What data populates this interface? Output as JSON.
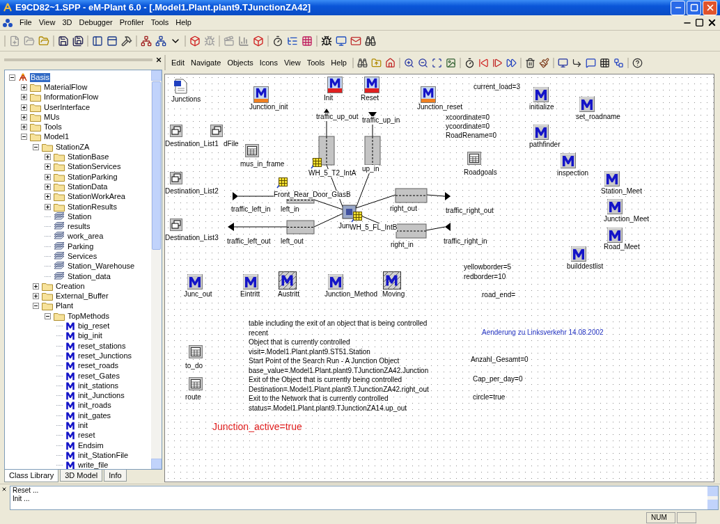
{
  "window": {
    "title": "E9CD82~1.SPP - eM-Plant 6.0 - [.Model1.Plant.plant9.TJunctionZA42]"
  },
  "menu": [
    "File",
    "View",
    "3D",
    "Debugger",
    "Profiler",
    "Tools",
    "Help"
  ],
  "class_library": {
    "tree": [
      {
        "label": "Basis",
        "kind": "root",
        "expanded": true,
        "selected": true,
        "children": [
          {
            "label": "MaterialFlow",
            "kind": "folder",
            "expanded": false,
            "selected": false
          },
          {
            "label": "InformationFlow",
            "kind": "folder",
            "expanded": false,
            "selected": false
          },
          {
            "label": "UserInterface",
            "kind": "folder",
            "expanded": false,
            "selected": false
          },
          {
            "label": "MUs",
            "kind": "folder",
            "expanded": false,
            "selected": false
          },
          {
            "label": "Tools",
            "kind": "folder",
            "expanded": false,
            "selected": false
          },
          {
            "label": "Model1",
            "kind": "folder",
            "expanded": true,
            "selected": false,
            "children": [
              {
                "label": "StationZA",
                "kind": "folder",
                "expanded": true,
                "selected": false,
                "children": [
                  {
                    "label": "StationBase",
                    "kind": "folder",
                    "expanded": false,
                    "selected": false
                  },
                  {
                    "label": "StationServices",
                    "kind": "folder",
                    "expanded": false,
                    "selected": false
                  },
                  {
                    "label": "StationParking",
                    "kind": "folder",
                    "expanded": false,
                    "selected": false
                  },
                  {
                    "label": "StationData",
                    "kind": "folder",
                    "expanded": false,
                    "selected": false
                  },
                  {
                    "label": "StationWorkArea",
                    "kind": "folder",
                    "expanded": false,
                    "selected": false
                  },
                  {
                    "label": "StationResults",
                    "kind": "folder",
                    "expanded": false,
                    "selected": false
                  },
                  {
                    "label": "Station",
                    "kind": "frame",
                    "selected": false
                  },
                  {
                    "label": "results",
                    "kind": "frame",
                    "selected": false
                  },
                  {
                    "label": "work_area",
                    "kind": "frame",
                    "selected": false
                  },
                  {
                    "label": "Parking",
                    "kind": "frame",
                    "selected": false
                  },
                  {
                    "label": "Services",
                    "kind": "frame",
                    "selected": false
                  },
                  {
                    "label": "Station_Warehouse",
                    "kind": "frame",
                    "selected": false
                  },
                  {
                    "label": "Station_data",
                    "kind": "frame",
                    "selected": false
                  }
                ]
              },
              {
                "label": "Creation",
                "kind": "folder",
                "expanded": false,
                "selected": false
              },
              {
                "label": "External_Buffer",
                "kind": "folder",
                "expanded": false,
                "selected": false
              },
              {
                "label": "Plant",
                "kind": "folder",
                "expanded": true,
                "selected": false,
                "children": [
                  {
                    "label": "TopMethods",
                    "kind": "folder",
                    "expanded": true,
                    "selected": false,
                    "children": [
                      {
                        "label": "big_reset",
                        "kind": "method",
                        "selected": false
                      },
                      {
                        "label": "big_init",
                        "kind": "method",
                        "selected": false
                      },
                      {
                        "label": "reset_stations",
                        "kind": "method",
                        "selected": false
                      },
                      {
                        "label": "reset_Junctions",
                        "kind": "method",
                        "selected": false
                      },
                      {
                        "label": "reset_roads",
                        "kind": "method",
                        "selected": false
                      },
                      {
                        "label": "reset_Gates",
                        "kind": "method",
                        "selected": false
                      },
                      {
                        "label": "init_stations",
                        "kind": "method",
                        "selected": false
                      },
                      {
                        "label": "init_Junctions",
                        "kind": "method",
                        "selected": false
                      },
                      {
                        "label": "init_roads",
                        "kind": "method",
                        "selected": false
                      },
                      {
                        "label": "init_gates",
                        "kind": "method",
                        "selected": false
                      },
                      {
                        "label": "init",
                        "kind": "method",
                        "selected": false
                      },
                      {
                        "label": "reset",
                        "kind": "method",
                        "selected": false
                      },
                      {
                        "label": "Endsim",
                        "kind": "method",
                        "selected": false
                      },
                      {
                        "label": "init_StationFile",
                        "kind": "method",
                        "selected": false
                      },
                      {
                        "label": "write_file",
                        "kind": "method",
                        "selected": false
                      }
                    ]
                  }
                ]
              }
            ]
          }
        ]
      }
    ],
    "tabs": [
      {
        "label": "Class Library",
        "selected": true
      },
      {
        "label": "3D Model",
        "selected": false
      },
      {
        "label": "Info",
        "selected": false
      }
    ]
  },
  "editor": {
    "menu": [
      "Edit",
      "Navigate",
      "Objects",
      "Icons",
      "View",
      "Tools",
      "Help"
    ],
    "objects": [
      {
        "kind": "document",
        "label": "Junctions"
      },
      {
        "kind": "method_orange",
        "label": "Junction_init"
      },
      {
        "kind": "method_red",
        "label": "Init"
      },
      {
        "kind": "method_red",
        "label": "Reset"
      },
      {
        "kind": "method_orange",
        "label": "Junction_reset"
      },
      {
        "kind": "method",
        "label": "initialize"
      },
      {
        "kind": "method",
        "label": "set_roadname"
      },
      {
        "kind": "frame",
        "label": "Destination_List1"
      },
      {
        "kind": "frame",
        "label": "dFile"
      },
      {
        "kind": "method",
        "label": "pathfinder"
      },
      {
        "kind": "table",
        "label": "mus_in_frame"
      },
      {
        "kind": "source",
        "label": "WH_5_T2_IntA"
      },
      {
        "kind": "table",
        "label": "Roadgoals"
      },
      {
        "kind": "method",
        "label": "inspection"
      },
      {
        "kind": "frame",
        "label": "Destination_List2"
      },
      {
        "kind": "source",
        "label": "Front_Rear_Door_GlasB"
      },
      {
        "kind": "method",
        "label": "Station_Meet"
      },
      {
        "kind": "method",
        "label": "Junction_Meet"
      },
      {
        "kind": "frame",
        "label": "Destination_List3"
      },
      {
        "kind": "method",
        "label": "Road_Meet"
      },
      {
        "kind": "method",
        "label": "builddestlist"
      },
      {
        "kind": "method",
        "label": "Junc_out"
      },
      {
        "kind": "method",
        "label": "Eintritt"
      },
      {
        "kind": "method_hatched",
        "label": "Austritt"
      },
      {
        "kind": "method",
        "label": "Junction_Method"
      },
      {
        "kind": "method_hatched",
        "label": "Moving"
      },
      {
        "kind": "table",
        "label": "to_do"
      },
      {
        "kind": "table",
        "label": "route"
      },
      {
        "kind": "source",
        "label": "WH_5_FL_IntB"
      }
    ],
    "labels": [
      "traffic_up_out",
      "traffic_up_in",
      "up_in",
      "traffic_left_in",
      "left_in",
      "right_out",
      "traffic_right_out",
      "Jun",
      "traffic_left_out",
      "left_out",
      "right_in",
      "traffic_right_in"
    ],
    "attributes": [
      "current_load=3",
      "xcoordinate=0",
      "ycoordinate=0",
      "RoadRename=0",
      "yellowborder=5",
      "redborder=10",
      "road_end=",
      "Anzahl_Gesamt=0",
      "Cap_per_day=0",
      "circle=true"
    ],
    "notes": [
      "table including the exit of an object that is being controlled",
      "recent",
      "Object that is currently controlled",
      "visit=.Model1.Plant.plant9.ST51.Station",
      "Start Point of the Search Run - A Junction Object",
      "base_value=.Model1.Plant.plant9.TJunctionZA42.Junction",
      "Exit of the Object that is currently being controlled",
      "Destination=.Model1.Plant.plant9.TJunctionZA42.right_out",
      "Exit to the Network that is currently controlled",
      "status=.Model1.Plant.plant9.TJunctionZA14.up_out"
    ],
    "comment": "Aenderung zu Linksverkehr 14.08.2002",
    "status_text": "Junction_active=true"
  },
  "console": {
    "lines": [
      "Reset ...",
      "Init ..."
    ]
  },
  "status_bar": {
    "indicator": "NUM"
  }
}
